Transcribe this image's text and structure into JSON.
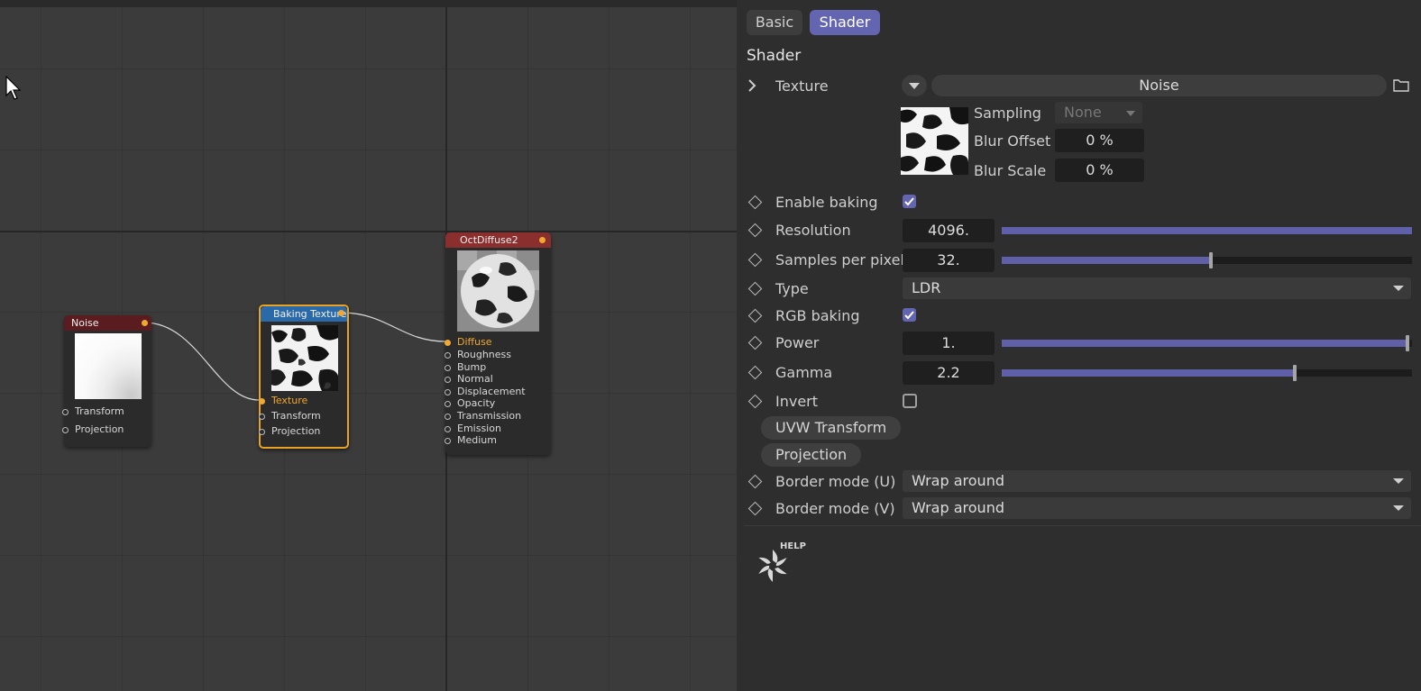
{
  "editor": {
    "nodes": {
      "noise": {
        "title": "Noise",
        "ports": [
          "Transform",
          "Projection"
        ]
      },
      "baking": {
        "title": "Baking Texture",
        "ports": [
          "Texture",
          "Transform",
          "Projection"
        ],
        "active_port": "Texture"
      },
      "diffuse": {
        "title": "OctDiffuse2",
        "ports": [
          "Diffuse",
          "Roughness",
          "Bump",
          "Normal",
          "Displacement",
          "Opacity",
          "Transmission",
          "Emission",
          "Medium"
        ],
        "active_port": "Diffuse"
      }
    },
    "colors": {
      "wire": "#d8d8d8",
      "port_active": "#f0a830",
      "selected_border": "#e8a327"
    }
  },
  "panel": {
    "tabs": {
      "basic": "Basic",
      "shader": "Shader"
    },
    "active_tab": "Shader",
    "section_title": "Shader",
    "texture": {
      "label": "Texture",
      "value": "Noise",
      "sampling_label": "Sampling",
      "sampling_value": "None",
      "blur_offset_label": "Blur Offset",
      "blur_offset_value": "0 %",
      "blur_scale_label": "Blur Scale",
      "blur_scale_value": "0 %"
    },
    "enable_baking": {
      "label": "Enable baking",
      "checked": true
    },
    "resolution": {
      "label": "Resolution",
      "value": "4096.",
      "fraction": 1.0
    },
    "samples": {
      "label": "Samples per pixel",
      "value": "32.",
      "fraction": 0.51
    },
    "type": {
      "label": "Type",
      "value": "LDR"
    },
    "rgb_baking": {
      "label": "RGB baking",
      "checked": true
    },
    "power": {
      "label": "Power",
      "value": "1.",
      "fraction": 0.99
    },
    "gamma": {
      "label": "Gamma",
      "value": "2.2",
      "fraction": 0.715
    },
    "invert": {
      "label": "Invert",
      "checked": false
    },
    "uvw_transform": "UVW Transform",
    "projection": "Projection",
    "border_u": {
      "label": "Border mode (U)",
      "value": "Wrap around"
    },
    "border_v": {
      "label": "Border mode (V)",
      "value": "Wrap around"
    },
    "help_label": "HELP",
    "accent_color": "#6465b0"
  }
}
